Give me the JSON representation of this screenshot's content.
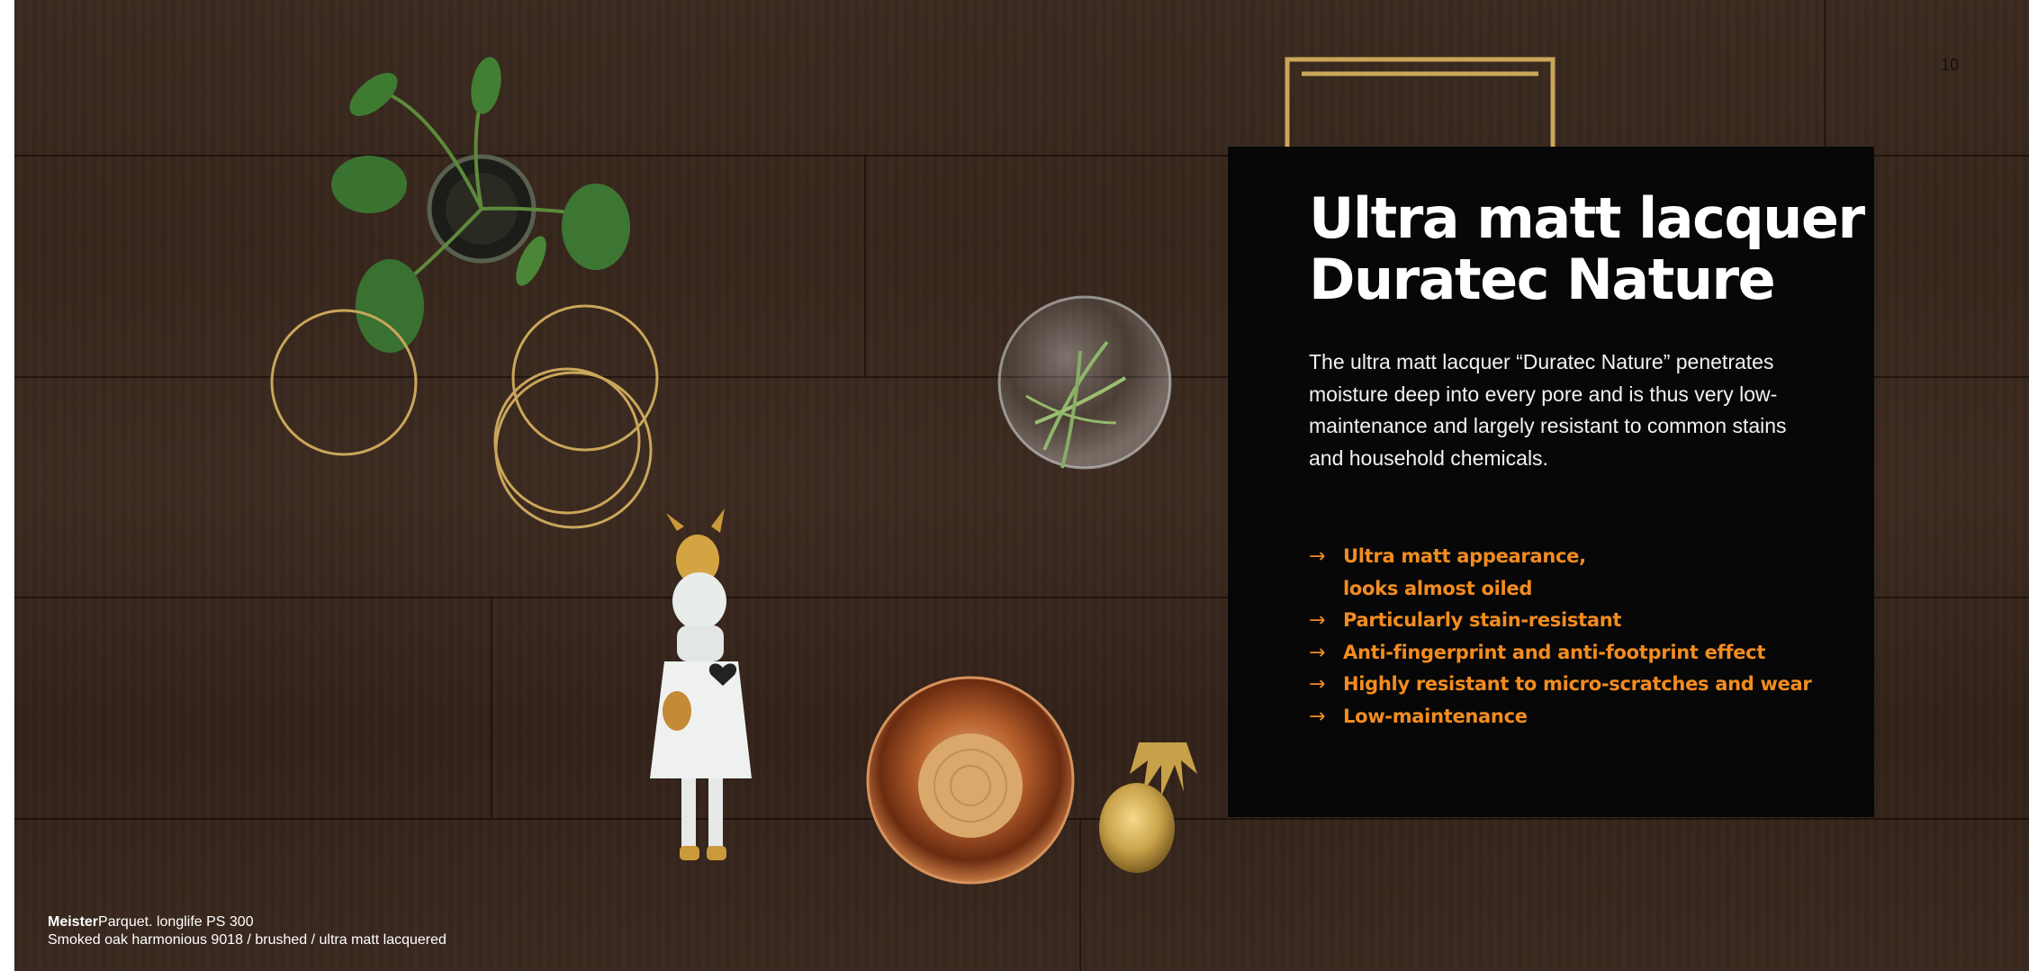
{
  "page_number": "10",
  "info_box": {
    "title_line1": "Ultra matt lacquer",
    "title_line2": "Duratec Nature",
    "body": "The ultra matt lacquer “Duratec Nature” penetrates moisture deep into every pore and is thus very low-maintenance and largely resistant to common stains and household chemicals.",
    "arrow_glyph": "→",
    "features": [
      {
        "line1": "Ultra matt appearance,",
        "line2": "looks almost oiled"
      },
      {
        "line1": "Particularly stain-resistant"
      },
      {
        "line1": "Anti-fingerprint and anti-footprint effect"
      },
      {
        "line1": "Highly resistant to micro-scratches and wear"
      },
      {
        "line1": "Low-maintenance"
      }
    ]
  },
  "caption": {
    "brand": "Meister",
    "product": "Parquet. longlife PS 300",
    "description": "Smoked oak harmonious 9018 / brushed / ultra matt lacquered"
  },
  "colors": {
    "accent": "#f28c1f",
    "box_background": "#070707",
    "wood": "#3a291f"
  }
}
